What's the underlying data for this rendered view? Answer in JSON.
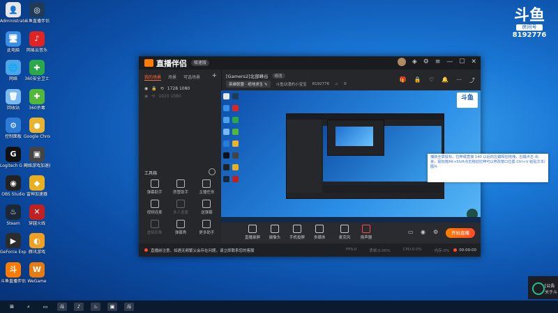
{
  "desktop": {
    "icons_col1": [
      {
        "label": "Administrator",
        "color": "#e7e7e7",
        "glyph": "👤"
      },
      {
        "label": "此电脑",
        "color": "#3a8ee6",
        "glyph": "🖥"
      },
      {
        "label": "网络",
        "color": "#4fa3e8",
        "glyph": "🌐"
      },
      {
        "label": "回收站",
        "color": "#7ab8f0",
        "glyph": "🗑"
      },
      {
        "label": "控制面板",
        "color": "#2c7bd6",
        "glyph": "⚙"
      },
      {
        "label": "Logitech G HUB",
        "color": "#111111",
        "glyph": "G"
      },
      {
        "label": "OBS Studio",
        "color": "#222222",
        "glyph": "◉"
      },
      {
        "label": "Steam",
        "color": "#1b2838",
        "glyph": "♨"
      },
      {
        "label": "GeForce Experience",
        "color": "#2c2c2c",
        "glyph": "▶"
      },
      {
        "label": "斗鱼直播伴侣",
        "color": "#ff7a00",
        "glyph": "斗"
      }
    ],
    "icons_col2": [
      {
        "label": "斗鱼直播伴侣",
        "color": "#1f3b55",
        "glyph": "◎"
      },
      {
        "label": "网易云音乐",
        "color": "#e02424",
        "glyph": "♪"
      },
      {
        "label": "360安全卫士",
        "color": "#2aa84a",
        "glyph": "✚"
      },
      {
        "label": "360杀毒",
        "color": "#53b83a",
        "glyph": "✚"
      },
      {
        "label": "Google Chrome",
        "color": "#e9b32c",
        "glyph": "●"
      },
      {
        "label": "网络游戏加速器",
        "color": "#444444",
        "glyph": "▣"
      },
      {
        "label": "雷神加速器",
        "color": "#e8b020",
        "glyph": "◆"
      },
      {
        "label": "穿越火线",
        "color": "#c02020",
        "glyph": "✕"
      },
      {
        "label": "腾讯游戏",
        "color": "#f0a020",
        "glyph": "◐"
      },
      {
        "label": "WeGame",
        "color": "#e87b10",
        "glyph": "W"
      }
    ]
  },
  "corner_logo": {
    "brand": "斗鱼",
    "room_label": "房间号",
    "room_number": "8192776"
  },
  "app": {
    "brand": "直播伴侣",
    "brand_badge": "极速版",
    "left_tabs": [
      "我的场景",
      "场景",
      "可选场景"
    ],
    "add_scene": "+",
    "sources": [
      {
        "label": "1728 1080",
        "dim": false
      },
      {
        "label": "1920 1080",
        "dim": true
      }
    ],
    "tools_header": "工具箱",
    "tools": [
      {
        "label": "弹幕助手",
        "dim": false
      },
      {
        "label": "房管助手",
        "dim": false
      },
      {
        "label": "主播任务",
        "dim": false
      },
      {
        "label": "视频连麦",
        "dim": false
      },
      {
        "label": "多人连麦",
        "dim": true
      },
      {
        "label": "送弹幕",
        "dim": false
      },
      {
        "label": "虚拟形象",
        "dim": true
      },
      {
        "label": "弹幕秀",
        "dim": false
      },
      {
        "label": "更多助手",
        "dim": false
      }
    ],
    "room_title": "[Gamers2]北部峰谷",
    "room_tag": "修改",
    "category": "英雄联盟 · 绝地求生",
    "room_owner": "斗鱼动漫的小宝宝",
    "room_number": "8192776",
    "heat": "0",
    "bottom_buttons": [
      "直播录屏",
      "摄像头",
      "手机投屏",
      "多媒体",
      "麦克风",
      "扬声器"
    ],
    "go_live": "开始直播",
    "notice": "直播前注意，如遇无频繁父会存在问题，请立即联系您的客服",
    "stats": [
      "FPS:0",
      "丢帧:0.00%",
      "CPU:0.0%",
      "内存:0%"
    ],
    "timer": "00:00:00",
    "tooltip": "捕获全屏鼠标，拉伸或直接 140 以后的左键相应拖拽，右键点击 出来，鼠标按Alt+Shift点击拖动拉伸可以修改窗口位置 Ctrl+V 粘贴文本/图片",
    "preview_logo": "斗鱼"
  },
  "taskbar": [
    "⊞",
    "⌕",
    "▭",
    "斗",
    "♪",
    "♨",
    "▣",
    "斗"
  ],
  "side_panel": {
    "line1": "[公告",
    "line2": "关于斗"
  }
}
